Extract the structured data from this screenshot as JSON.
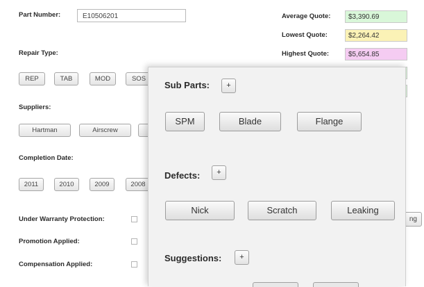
{
  "form": {
    "part_number_label": "Part Number:",
    "part_number_value": "E10506201",
    "repair_type_label": "Repair Type:",
    "repair_types": [
      "REP",
      "TAB",
      "MOD",
      "SOS"
    ],
    "suppliers_label": "Suppliers:",
    "suppliers": [
      "Hartman",
      "Airscrew"
    ],
    "completion_date_label": "Completion Date:",
    "years": [
      "2011",
      "2010",
      "2009",
      "2008"
    ],
    "warranty_label": "Under Warranty Protection:",
    "promotion_label": "Promotion Applied:",
    "compensation_label": "Compensation Applied:"
  },
  "quotes": {
    "average_label": "Average Quote:",
    "average_value": "$3,390.69",
    "lowest_label": "Lowest Quote:",
    "lowest_value": "$2,264.42",
    "highest_label": "Highest Quote:",
    "highest_value": "$5,654.85",
    "colors": {
      "average": "#d9f7d9",
      "lowest": "#fbf2b6",
      "highest": "#f5ccf2",
      "extra": "#d9f7d9"
    }
  },
  "panel": {
    "sub_parts_label": "Sub Parts:",
    "sub_parts": [
      "SPM",
      "Blade",
      "Flange"
    ],
    "defects_label": "Defects:",
    "defects": [
      "Nick",
      "Scratch",
      "Leaking"
    ],
    "suggestions_label": "Suggestions:",
    "add_symbol": "+",
    "partial_button_text": "ng"
  }
}
